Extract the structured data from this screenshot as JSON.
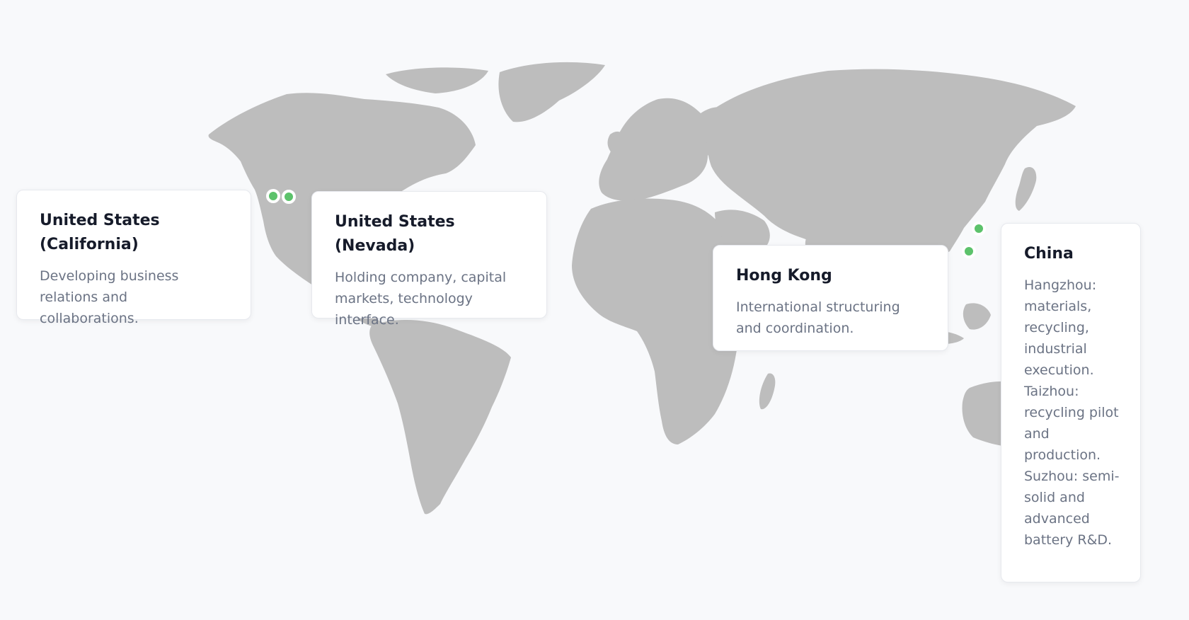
{
  "map": {
    "marker_color": "#5cc26b",
    "land_color": "#bdbdbd",
    "background_color": "#f8f9fb"
  },
  "locations": [
    {
      "id": "california",
      "title": "United States (California)",
      "description": "Developing business relations and collaborations."
    },
    {
      "id": "nevada",
      "title": "United States (Nevada)",
      "description": "Holding company, capital markets, technology interface."
    },
    {
      "id": "hong-kong",
      "title": "Hong Kong",
      "description": "International structuring and coordination."
    },
    {
      "id": "china",
      "title": "China",
      "description": "Hangzhou: materials, recycling, industrial execution. Taizhou: recycling pilot and production. Suzhou: semi-solid and advanced battery R&D."
    }
  ]
}
